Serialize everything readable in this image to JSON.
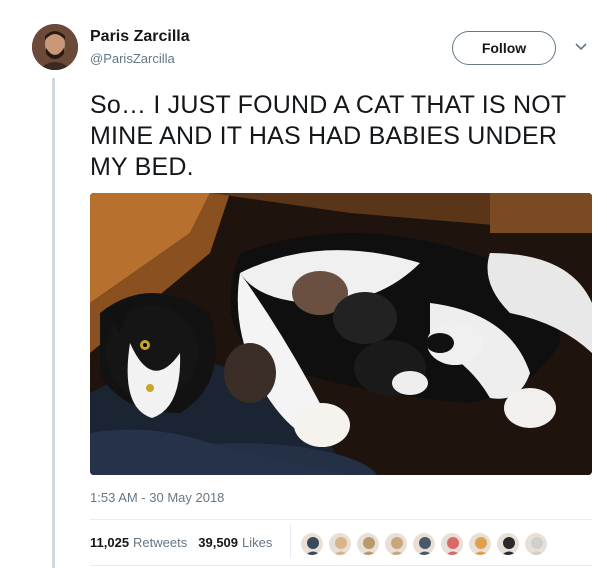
{
  "author": {
    "name": "Paris Zarcilla",
    "handle": "@ParisZarcilla",
    "avatar_icon": "avatar-photo"
  },
  "follow_label": "Follow",
  "tweet_text": "So… I JUST FOUND A CAT THAT IS NOT MINE AND IT HAS HAD BABIES UNDER MY BED.",
  "media": {
    "icon": "cat-with-kittens-photo"
  },
  "timestamp": "1:53 AM - 30 May 2018",
  "stats": {
    "retweets_count": "11,025",
    "retweets_label": "Retweets",
    "likes_count": "39,509",
    "likes_label": "Likes"
  },
  "likers": [
    {
      "color": "#3b4a5a"
    },
    {
      "color": "#d8b48a"
    },
    {
      "color": "#b89a6a"
    },
    {
      "color": "#c9a77a"
    },
    {
      "color": "#4a5868"
    },
    {
      "color": "#d96a6a"
    },
    {
      "color": "#e0a050"
    },
    {
      "color": "#2a2a2a"
    },
    {
      "color": "#cfcfcf"
    }
  ],
  "colors": {
    "text": "#14171a",
    "secondary": "#657786",
    "border": "#e6ecf0"
  }
}
